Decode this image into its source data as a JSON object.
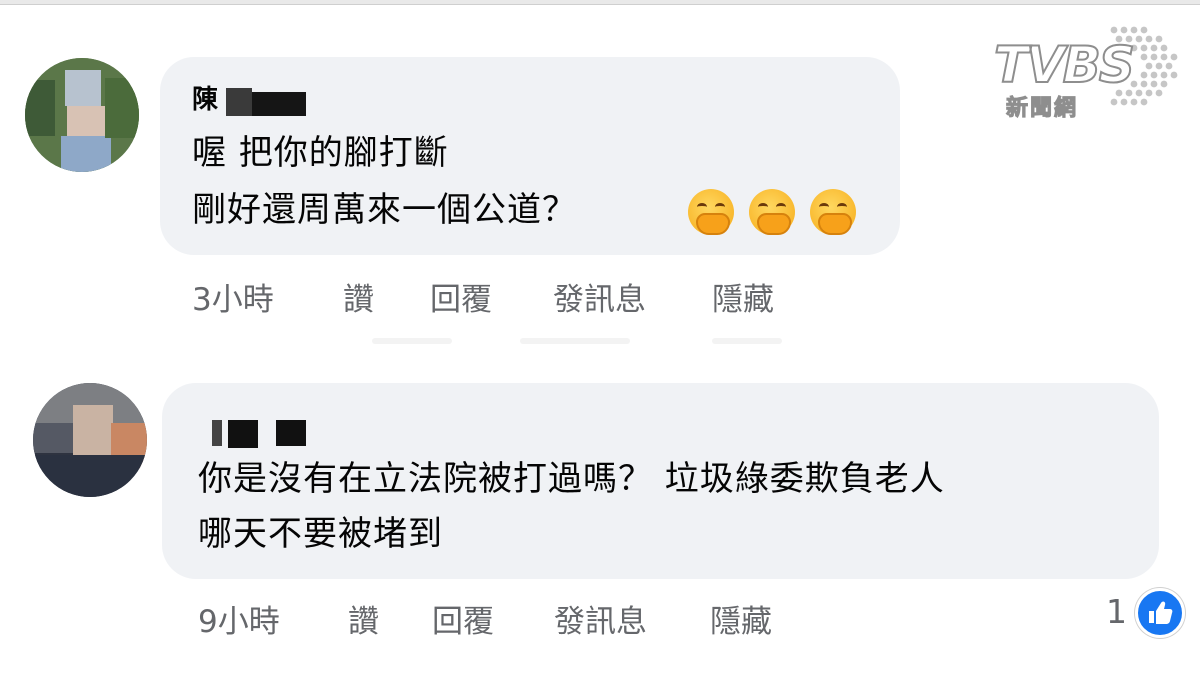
{
  "comments": [
    {
      "author_visible": "陳",
      "lines": [
        "喔 把你的腳打斷",
        "剛好還周萬來一個公道？"
      ],
      "emoji": [
        "face-with-hand-over-mouth",
        "face-with-hand-over-mouth",
        "face-with-hand-over-mouth"
      ],
      "time": "3小時",
      "actions": [
        "讚",
        "回覆",
        "發訊息",
        "隱藏"
      ]
    },
    {
      "author_visible": "",
      "lines": [
        "你是沒有在立法院被打過嗎？ 垃圾綠委欺負老人",
        "哪天不要被堵到"
      ],
      "time": "9小時",
      "actions": [
        "讚",
        "回覆",
        "發訊息",
        "隱藏"
      ],
      "reaction_count": "1",
      "reaction_icon": "like-thumb-icon"
    }
  ],
  "watermark": {
    "brand": "TVBS",
    "sub": "新聞網"
  },
  "colors": {
    "bubble": "#f0f2f5",
    "secondary_text": "#65676b",
    "like_blue": "#1877f2"
  }
}
